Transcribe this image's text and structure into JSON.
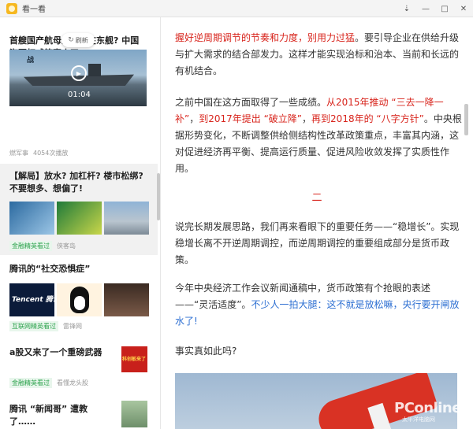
{
  "window": {
    "title": "看一看",
    "controls": [
      "⇣",
      "—",
      "□",
      "✕"
    ]
  },
  "feed": {
    "refresh_label": "刷新",
    "items": [
      {
        "title": "首艘国产航母为何不在东舰? 中国海军权威答案来了",
        "video_duration": "01:04",
        "video_caption": "战",
        "source": "燃军事",
        "plays": "4054次播放"
      },
      {
        "title": "【解局】放水? 加杠杆? 楼市松绑? 不要想多、想偏了!",
        "tag": "金融精英看过",
        "source": "侠客岛"
      },
      {
        "title": "腾讯的“社交恐惧症”",
        "tag": "互联网精英看过",
        "source": "雷锋网",
        "thumb_text": "Tencent 腾讯"
      },
      {
        "title": "a股又来了一个重磅武器",
        "tag": "金融精英看过",
        "source": "看懂龙头股",
        "thumb_text": "科创板来了"
      },
      {
        "title": "腾讯 “新闻哥” 遭教了……"
      }
    ]
  },
  "article": {
    "p1_red": "握好逆周期调节的节奏和力度，别用力过猛",
    "p1_rest": "。要引导企业在供给升级与扩大需求的结合部发力。这样才能实现治标和治本、当前和长远的有机结合。",
    "p2_a": "之前中国在这方面取得了一些成绩。",
    "p2_red1": "从2015年推动 “三去一降一补”",
    "p2_b": "，",
    "p2_red2": "到2017年提出 “破立降”",
    "p2_c": "，",
    "p2_red3": "再到2018年的 “八字方针”",
    "p2_d": "。中央根据形势变化，不断调整供给侧结构性改革政策重点，丰富其内涵，这对促进经济再平衡、提高运行质量、促进风险收敛发挥了实质性作用。",
    "section_mark": "二",
    "p3": "说完长期发展思路，我们再来看眼下的重要任务——“稳增长”。实现稳增长离不开逆周期调控，而逆周期调控的重要组成部分是货币政策。",
    "p4_a": "今年中央经济工作会议新闻通稿中，货币政策有个抢眼的表述——“灵活适度”。",
    "p4_blue": "不少人一拍大腿：这不就是放松嘛，央行要开闸放水了!",
    "p5": "事实真如此吗?",
    "watermark": "PConline",
    "watermark_sub": "太平洋电脑网"
  },
  "colors": {
    "accent_red": "#d8251d",
    "accent_blue": "#2d6fd2",
    "tag_green": "#2ba24c"
  }
}
